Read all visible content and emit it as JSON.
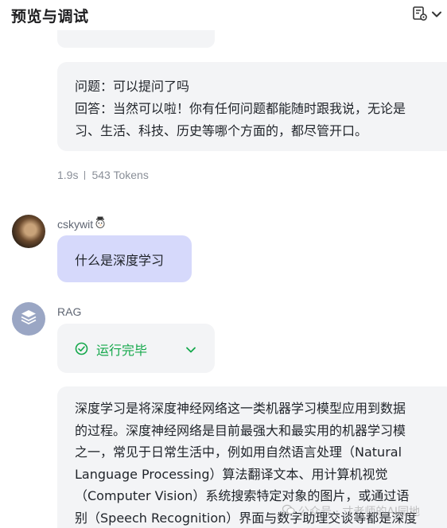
{
  "header": {
    "title": "预览与调试",
    "menu_icon": "document-settings-icon",
    "dropdown_icon": "chevron-down-icon"
  },
  "chat": {
    "previous_answer": {
      "lines": [
        "问题：可以提问了吗",
        "回答：当然可以啦！你有任何问题都能随时跟我说，无论是",
        "习、生活、科技、历史等哪个方面的，都尽管开口。"
      ]
    },
    "meta": {
      "latency": "1.9s",
      "tokens": "543 Tokens"
    },
    "user": {
      "name": "cskywit",
      "badge_icon": "snowman-icon",
      "message": "什么是深度学习"
    },
    "bot": {
      "name": "RAG",
      "avatar_icon": "layers-icon",
      "status": "运行完毕",
      "status_icon": "check-circle-icon",
      "answer_lines": [
        "深度学习是将深度神经网络这一类机器学习模型应用到数据",
        "的过程。深度神经网络是目前最强大和最实用的机器学习模",
        "之一，常见于日常生活中，例如用自然语言处理（Natural",
        "Language Processing）算法翻译文本、用计算机视觉",
        "（Computer Vision）系统搜索特定对象的图片，或通过语",
        "别（Speech Recognition）界面与数字助理交谈等都是深度"
      ]
    }
  },
  "watermark": {
    "text": "公众号 · 寸老师的AI园地"
  },
  "colors": {
    "accent_success": "#14a84b",
    "user_bubble": "#d6d9fb",
    "card_bg": "#f3f4f6"
  }
}
